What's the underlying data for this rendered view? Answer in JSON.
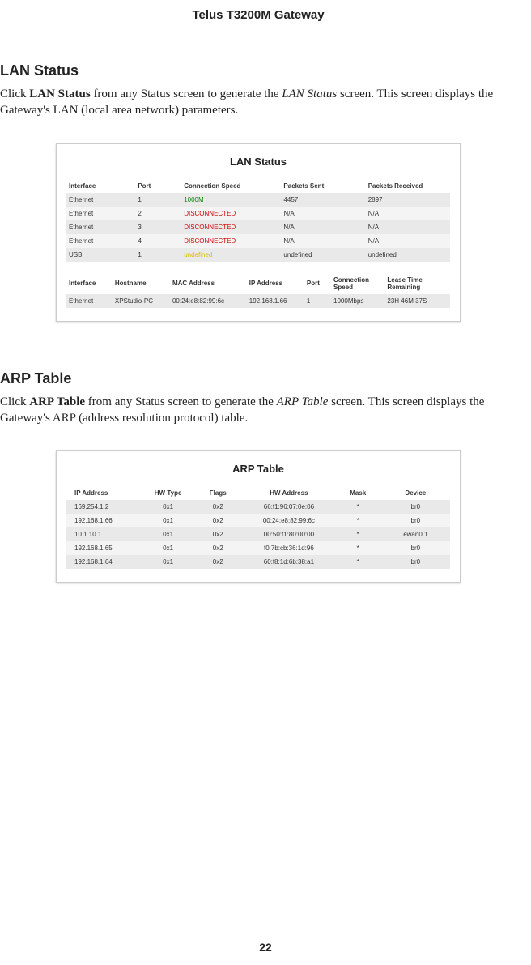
{
  "header": {
    "title": "Telus T3200M Gateway"
  },
  "lan": {
    "heading": "LAN Status",
    "para_pre": "Click ",
    "para_bold": "LAN Status",
    "para_mid": " from any Status screen to generate the ",
    "para_ital": "LAN Status",
    "para_post": " screen. This screen displays the Gateway's LAN (local area network) parameters.",
    "panel_title": "LAN Status",
    "cols1": [
      "Interface",
      "Port",
      "Connection Speed",
      "Packets Sent",
      "Packets Received"
    ],
    "rows1": [
      {
        "iface": "Ethernet",
        "port": "1",
        "speed": "1000M",
        "speed_class": "conn-green",
        "sent": "4457",
        "recv": "2897"
      },
      {
        "iface": "Ethernet",
        "port": "2",
        "speed": "DISCONNECTED",
        "speed_class": "conn-red",
        "sent": "N/A",
        "recv": "N/A"
      },
      {
        "iface": "Ethernet",
        "port": "3",
        "speed": "DISCONNECTED",
        "speed_class": "conn-red",
        "sent": "N/A",
        "recv": "N/A"
      },
      {
        "iface": "Ethernet",
        "port": "4",
        "speed": "DISCONNECTED",
        "speed_class": "conn-red",
        "sent": "N/A",
        "recv": "N/A"
      },
      {
        "iface": "USB",
        "port": "1",
        "speed": "undefined",
        "speed_class": "conn-yellow",
        "sent": "undefined",
        "recv": "undefined"
      }
    ],
    "cols2": [
      "Interface",
      "Hostname",
      "MAC Address",
      "IP Address",
      "Port",
      "Connection Speed",
      "Lease Time Remaining"
    ],
    "rows2": [
      {
        "iface": "Ethernet",
        "host": "XPStudio-PC",
        "mac": "00:24:e8:82:99:6c",
        "ip": "192.168.1.66",
        "port": "1",
        "speed": "1000Mbps",
        "lease": "23H 46M 37S"
      }
    ]
  },
  "arp": {
    "heading": "ARP Table",
    "para_pre": "Click ",
    "para_bold": "ARP Table",
    "para_mid": " from any Status screen to generate the ",
    "para_ital": "ARP Table",
    "para_post": " screen. This screen displays the Gateway's ARP (address resolution protocol) table.",
    "panel_title": "ARP Table",
    "cols": [
      "IP Address",
      "HW Type",
      "Flags",
      "HW Address",
      "Mask",
      "Device"
    ],
    "rows": [
      {
        "ip": "169.254.1.2",
        "hw": "0x1",
        "flags": "0x2",
        "hwa": "66:f1:96:07:0e:06",
        "mask": "*",
        "dev": "br0"
      },
      {
        "ip": "192.168.1.66",
        "hw": "0x1",
        "flags": "0x2",
        "hwa": "00:24:e8:82:99:6c",
        "mask": "*",
        "dev": "br0"
      },
      {
        "ip": "10.1.10.1",
        "hw": "0x1",
        "flags": "0x2",
        "hwa": "00:50:f1:80:00:00",
        "mask": "*",
        "dev": "ewan0.1"
      },
      {
        "ip": "192.168.1.65",
        "hw": "0x1",
        "flags": "0x2",
        "hwa": "f0:7b:cb:36:1d:96",
        "mask": "*",
        "dev": "br0"
      },
      {
        "ip": "192.168.1.64",
        "hw": "0x1",
        "flags": "0x2",
        "hwa": "60:f8:1d:6b:38:a1",
        "mask": "*",
        "dev": "br0"
      }
    ]
  },
  "page_number": "22"
}
